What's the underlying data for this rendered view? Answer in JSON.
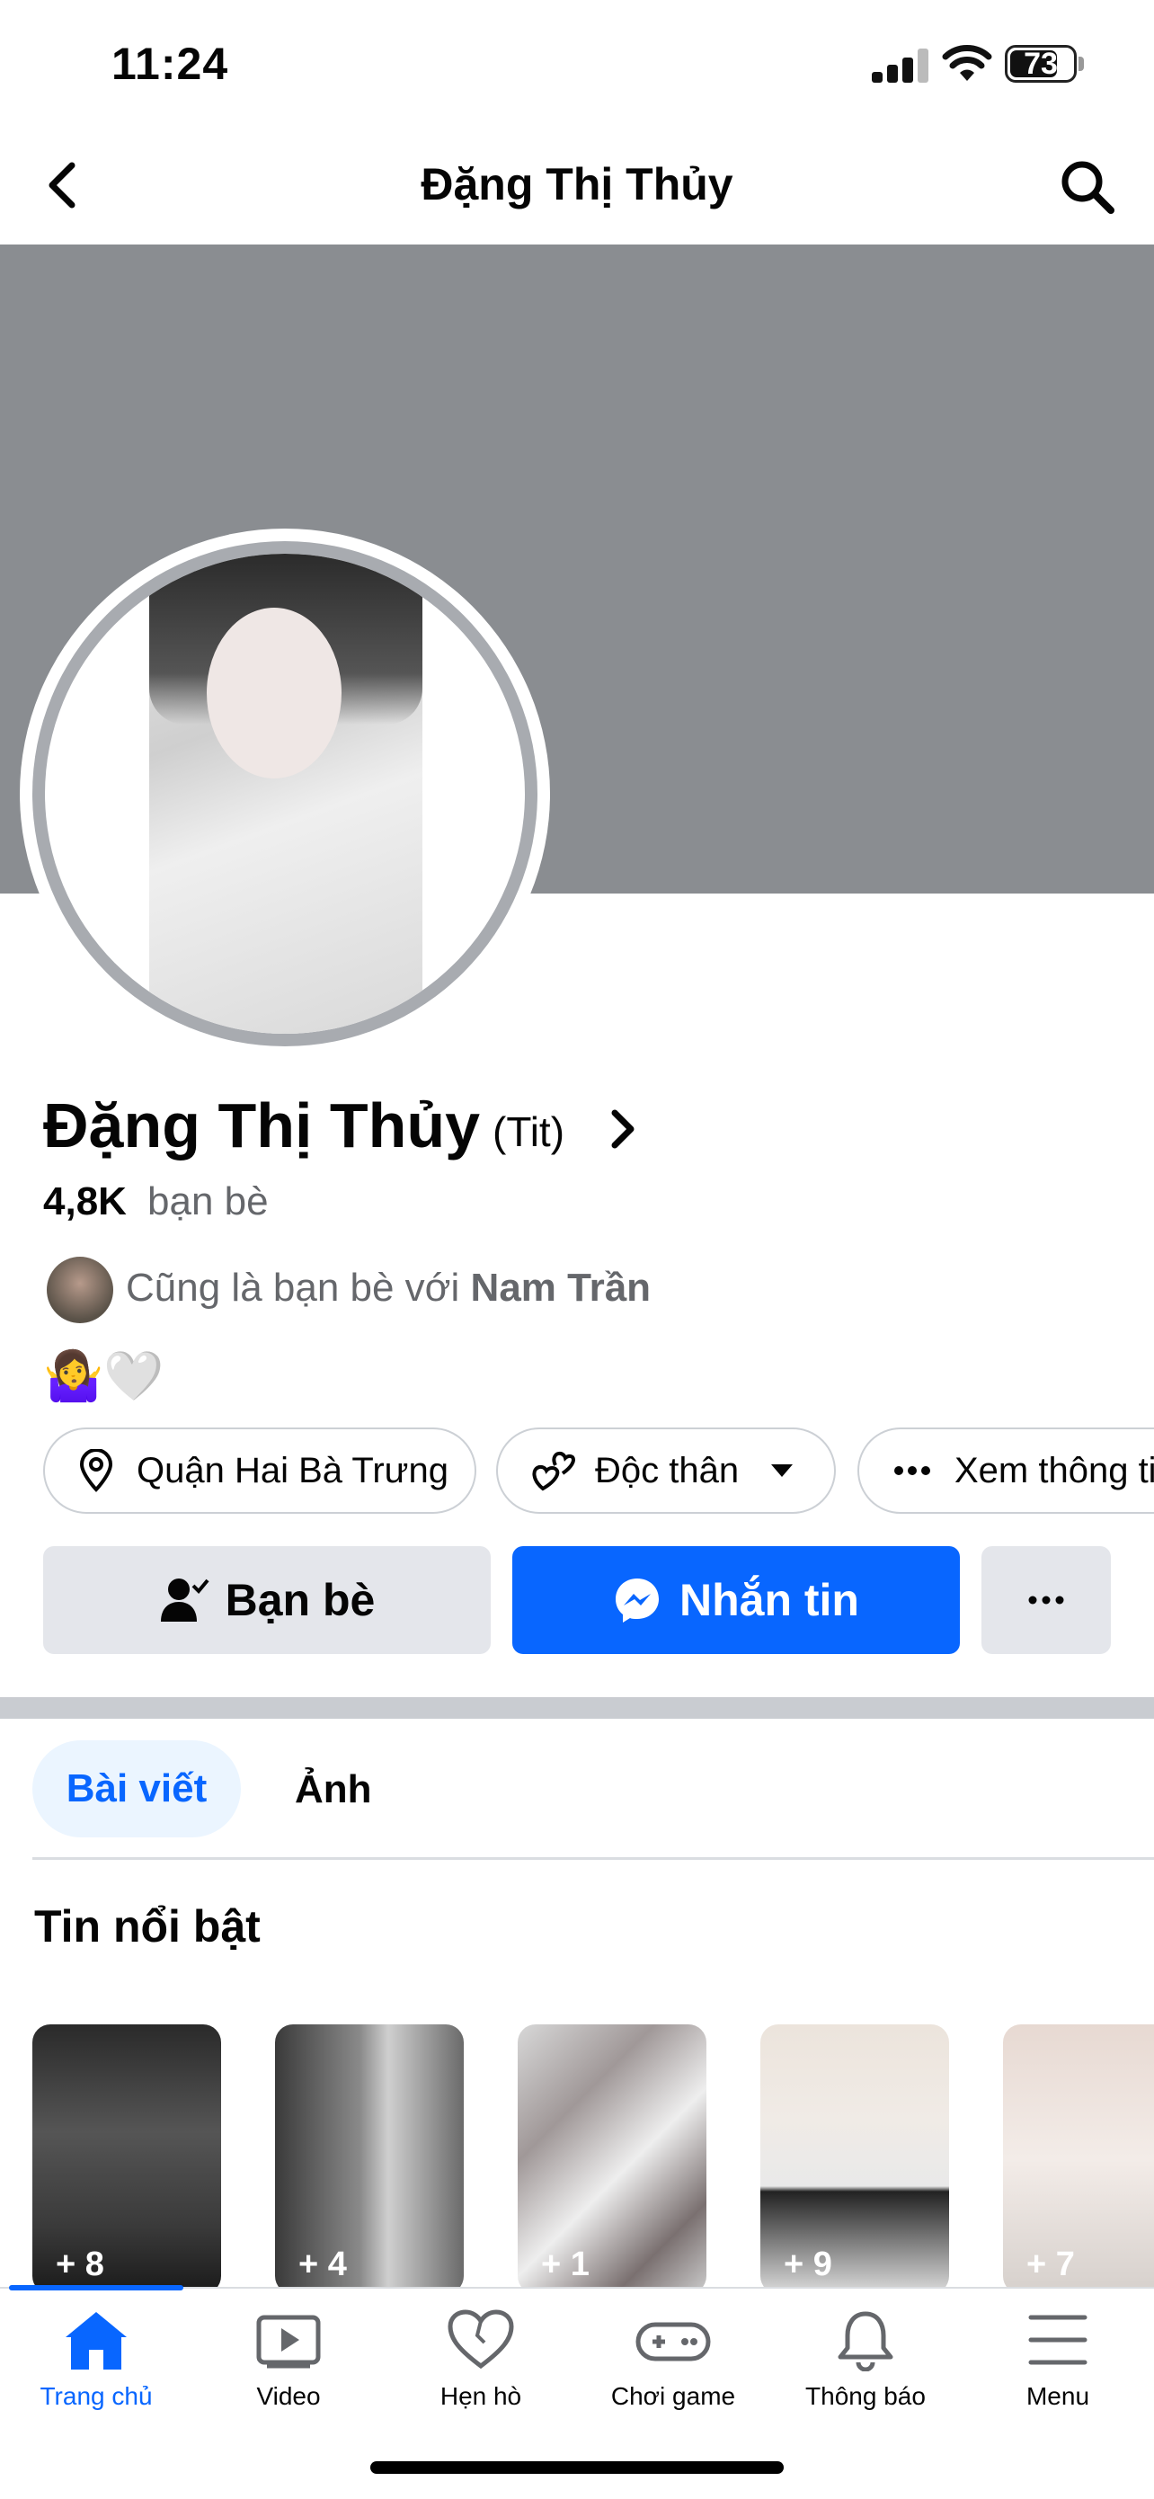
{
  "status_bar": {
    "time": "11:24",
    "battery": "73"
  },
  "header": {
    "title": "Đặng Thị Thủy"
  },
  "profile": {
    "name": "Đặng Thị Thủy",
    "nickname": "(Tit)",
    "friends_count": "4,8K",
    "friends_label": "bạn bè",
    "mutual_prefix": "Cũng là bạn bè với ",
    "mutual_name": "Nam Trần",
    "bio_emoji": "🤷‍♀️🤍"
  },
  "chips": [
    {
      "icon": "location-pin-icon",
      "label": "Quận Hai Bà Trưng"
    },
    {
      "icon": "hearts-icon",
      "label": "Độc thân"
    },
    {
      "icon": "more-dots-icon",
      "label": "Xem thông tin"
    }
  ],
  "actions": {
    "friends": "Bạn bè",
    "message": "Nhắn tin"
  },
  "tabs": {
    "posts": "Bài viết",
    "photos": "Ảnh"
  },
  "highlights": {
    "title": "Tin nổi bật",
    "stories": [
      {
        "count": "+ 8"
      },
      {
        "count": "+ 4"
      },
      {
        "count": "+ 1"
      },
      {
        "count": "+ 9"
      },
      {
        "count": "+ 7"
      }
    ]
  },
  "bottom_nav": [
    {
      "icon": "home-icon",
      "label": "Trang chủ",
      "active": true
    },
    {
      "icon": "video-icon",
      "label": "Video"
    },
    {
      "icon": "dating-heart-icon",
      "label": "Hẹn hò"
    },
    {
      "icon": "gamepad-icon",
      "label": "Chơi game"
    },
    {
      "icon": "bell-icon",
      "label": "Thông báo"
    },
    {
      "icon": "menu-icon",
      "label": "Menu"
    }
  ],
  "colors": {
    "accent": "#0866ff",
    "cover": "#8a8d91",
    "secondary_text": "#65676b"
  }
}
